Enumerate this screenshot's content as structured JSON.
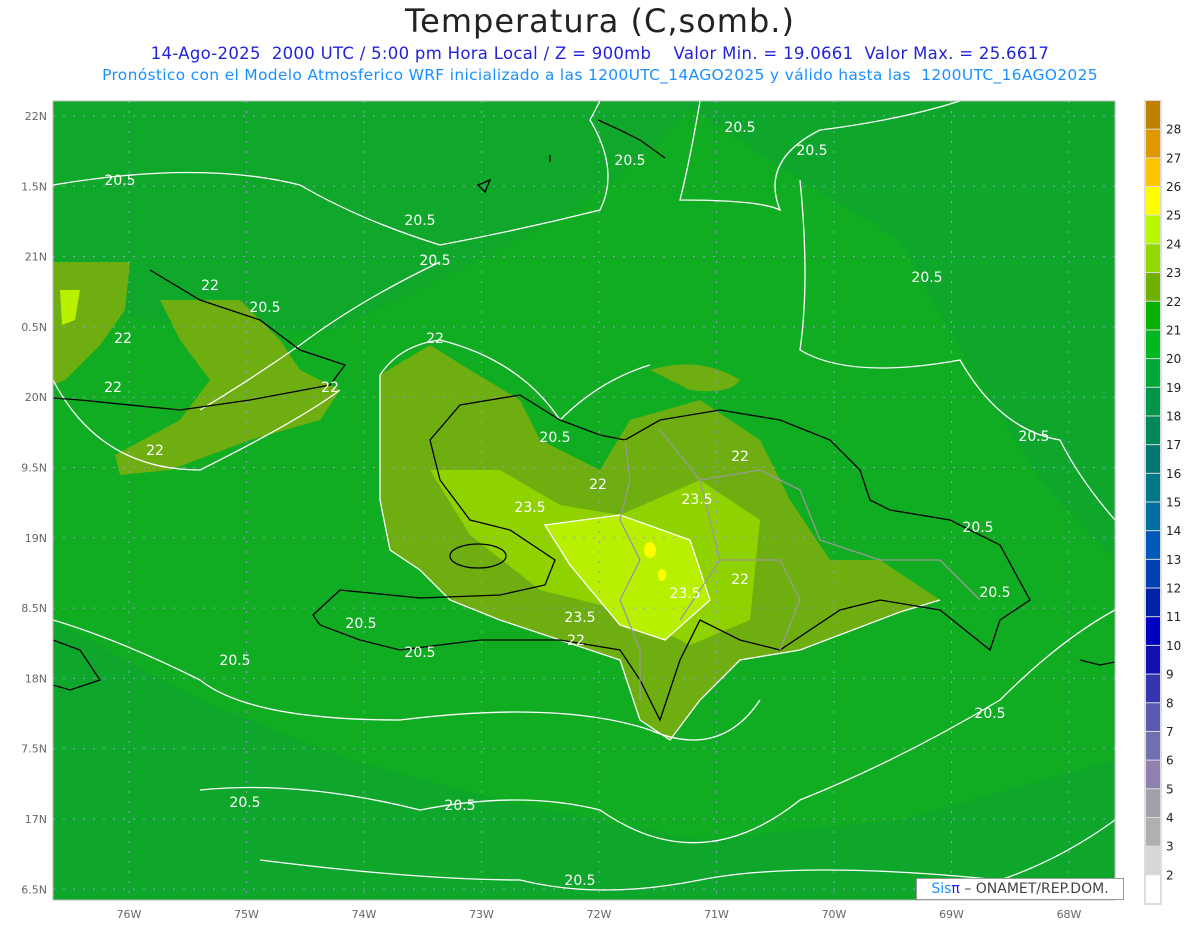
{
  "header": {
    "title": "Temperatura (C,somb.)",
    "line1": "14-Ago-2025  2000 UTC / 5:00 pm Hora Local / Z = 900mb    Valor Min. = 19.0661  Valor Max. = 25.6617",
    "line2": "Pronóstico con el Modelo Atmosferico WRF inicializado a las 1200UTC_14AGO2025 y válido hasta las  1200UTC_16AGO2025"
  },
  "axes": {
    "lon_labels": [
      "76W",
      "75W",
      "74W",
      "73W",
      "72W",
      "71W",
      "70W",
      "69W",
      "68W"
    ],
    "lat_labels": [
      "22N",
      "1.5N",
      "21N",
      "0.5N",
      "20N",
      "9.5N",
      "19N",
      "8.5N",
      "18N",
      "7.5N",
      "17N",
      "6.5N"
    ]
  },
  "colorbar": {
    "labels": [
      "28",
      "27",
      "26",
      "25",
      "24",
      "23",
      "22",
      "21",
      "20",
      "19",
      "18",
      "17",
      "16",
      "15",
      "14",
      "13",
      "12",
      "11",
      "10",
      "9",
      "8",
      "7",
      "6",
      "5",
      "4",
      "3",
      "2"
    ],
    "colors": [
      "#c08000",
      "#e09800",
      "#ffc400",
      "#ffff00",
      "#b8f800",
      "#90d800",
      "#70b000",
      "#08b000",
      "#00b820",
      "#00a838",
      "#009848",
      "#008858",
      "#007870",
      "#007888",
      "#0070a0",
      "#0058b8",
      "#0040b0",
      "#0020a8",
      "#0000c0",
      "#1010b0",
      "#3535b0",
      "#5a5ab0",
      "#7070b0",
      "#9080b0",
      "#a0a0a8",
      "#b0b0b0",
      "#d8d8d8",
      "#ffffff"
    ]
  },
  "map": {
    "background_color": "#10ac22",
    "contour_labels": [
      "20.5",
      "20.5",
      "20.5",
      "20.5",
      "20.5",
      "20.5",
      "20.5",
      "22",
      "22",
      "22",
      "22",
      "22",
      "20.5",
      "20.5",
      "20.5",
      "22",
      "23.5",
      "23.5",
      "22",
      "22",
      "20.5",
      "20.5",
      "23.5",
      "23.5",
      "22",
      "20.5",
      "20.5",
      "20.5",
      "20.5",
      "20.5",
      "20.5",
      "22",
      "20.5"
    ]
  },
  "credit": {
    "brand": "Sis",
    "brand_symbol": "π",
    "text": "– ONAMET/REP.DOM."
  }
}
